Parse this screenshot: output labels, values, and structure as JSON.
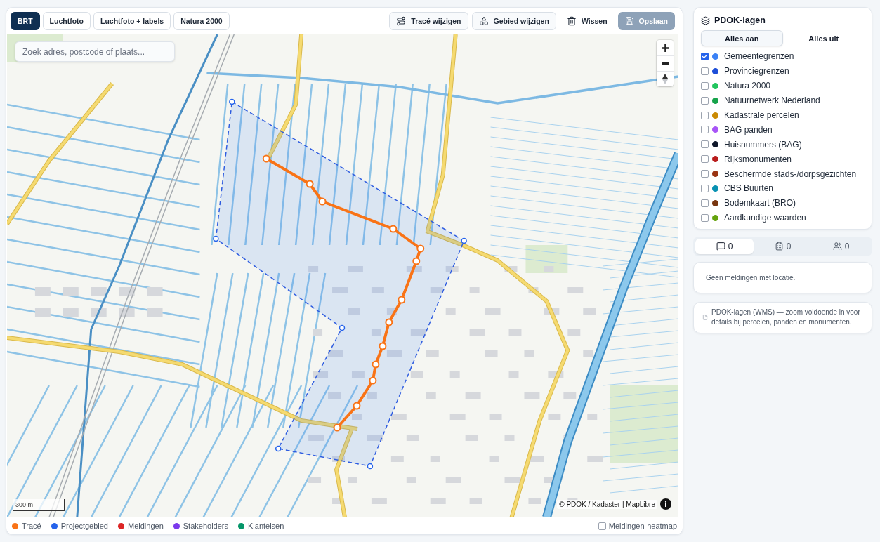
{
  "basemap_tabs": [
    {
      "label": "BRT",
      "selected": true
    },
    {
      "label": "Luchtfoto",
      "selected": false
    },
    {
      "label": "Luchtfoto + labels",
      "selected": false
    },
    {
      "label": "Natura 2000",
      "selected": false
    }
  ],
  "actions": [
    {
      "kind": "route",
      "label": "Tracé wijzigen",
      "disabled": false
    },
    {
      "kind": "area",
      "label": "Gebied wijzigen",
      "disabled": false
    },
    {
      "kind": "clear",
      "label": "Wissen",
      "disabled": false
    },
    {
      "kind": "save",
      "label": "Opslaan",
      "disabled": true
    }
  ],
  "map": {
    "search": {
      "placeholder": "Zoek adres, postcode of plaats..."
    },
    "scale": "300 m",
    "attribution": "© PDOK / Kadaster | MapLibre"
  },
  "legend": {
    "items": [
      {
        "label": "Tracé",
        "color": "#f97316"
      },
      {
        "label": "Projectgebied",
        "color": "#2563eb"
      },
      {
        "label": "Meldingen",
        "color": "#dc2626"
      },
      {
        "label": "Stakeholders",
        "color": "#7c3aed"
      },
      {
        "label": "Klanteisen",
        "color": "#059669"
      }
    ],
    "heatmap": {
      "label": "Meldingen-heatmap",
      "checked": false
    }
  },
  "layers_panel": {
    "title": "PDOK-lagen",
    "toggle": [
      {
        "label": "Alles aan",
        "selected": true
      },
      {
        "label": "Alles uit",
        "selected": false
      }
    ],
    "layers": [
      {
        "label": "Gemeentegrenzen",
        "color": "#3b82f6",
        "checked": true
      },
      {
        "label": "Provinciegrenzen",
        "color": "#1d4ed8",
        "checked": false
      },
      {
        "label": "Natura 2000",
        "color": "#22c55e",
        "checked": false
      },
      {
        "label": "Natuurnetwerk Nederland",
        "color": "#16a34a",
        "checked": false
      },
      {
        "label": "Kadastrale percelen",
        "color": "#ca8a04",
        "checked": false
      },
      {
        "label": "BAG panden",
        "color": "#a855f7",
        "checked": false
      },
      {
        "label": "Huisnummers (BAG)",
        "color": "#0f172a",
        "checked": false
      },
      {
        "label": "Rijksmonumenten",
        "color": "#b91c1c",
        "checked": false
      },
      {
        "label": "Beschermde stads-/dorpsgezichten",
        "color": "#9a3412",
        "checked": false
      },
      {
        "label": "CBS Buurten",
        "color": "#0891b2",
        "checked": false
      },
      {
        "label": "Bodemkaart (BRO)",
        "color": "#78350f",
        "checked": false
      },
      {
        "label": "Aardkundige waarden",
        "color": "#65a30d",
        "checked": false
      }
    ]
  },
  "count_tabs": [
    {
      "kind": "reports",
      "count": "0",
      "selected": true
    },
    {
      "kind": "tasks",
      "count": "0",
      "selected": false
    },
    {
      "kind": "people",
      "count": "0",
      "selected": false
    }
  ],
  "messages": {
    "empty_text": "Geen meldingen met locatie."
  },
  "info_note": {
    "text": "PDOK-lagen (WMS) — zoom voldoende in voor details bij percelen, panden en monumenten."
  }
}
